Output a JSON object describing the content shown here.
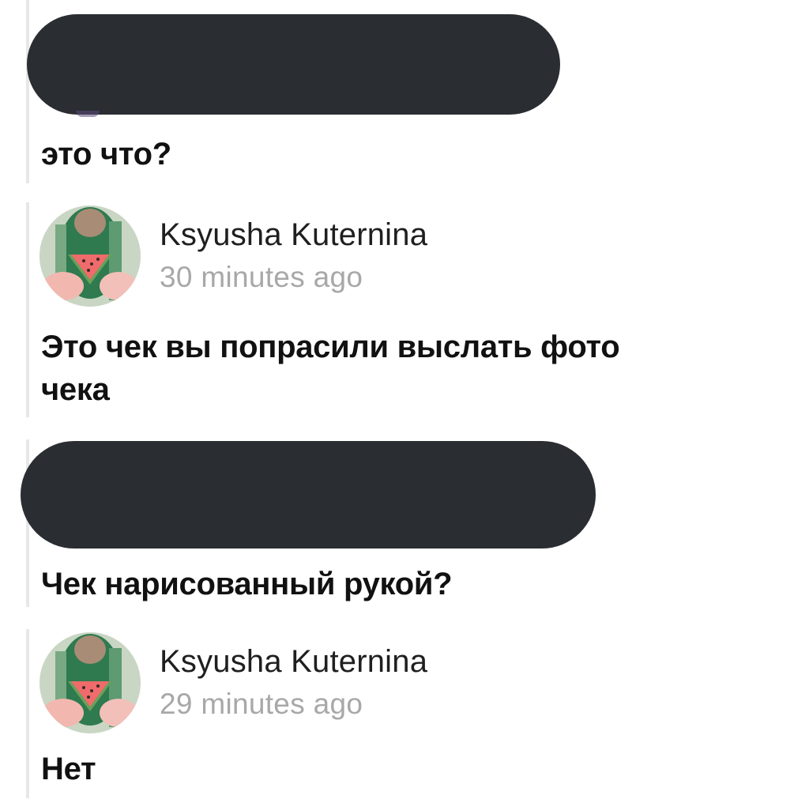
{
  "thread": {
    "messages": [
      {
        "author": "",
        "redacted_header": true,
        "text": "это что?"
      },
      {
        "author": "Ksyusha Kuternina",
        "time": "30 minutes ago",
        "avatar_icon": "watermelon-photo-avatar",
        "text": "Это чек вы попрасили выслать фото\nчека"
      },
      {
        "author": "",
        "redacted_header": true,
        "text": "Чек нарисованный рукой?"
      },
      {
        "author": "Ksyusha Kuternina",
        "time": "29 minutes ago",
        "avatar_icon": "watermelon-photo-avatar",
        "text": "Нет"
      }
    ]
  },
  "colors": {
    "redaction": "#2a2d31",
    "timestamp": "#a8a8a8",
    "thread_line": "#e7e7e7",
    "text": "#111111"
  }
}
